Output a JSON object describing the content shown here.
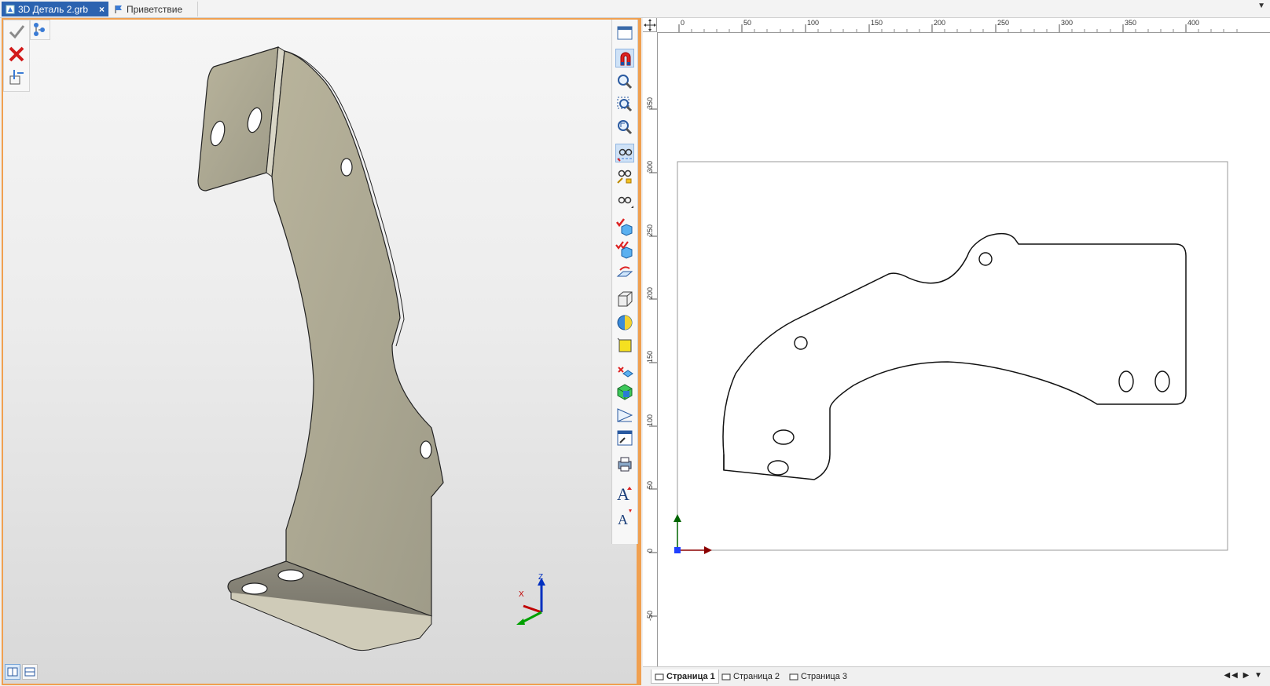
{
  "tabs": [
    {
      "label": "3D Деталь 2.grb",
      "active": true,
      "close": "×"
    },
    {
      "label": "Приветствие",
      "active": false
    }
  ],
  "ruler": {
    "top_labels": [
      "0",
      "50",
      "100",
      "150",
      "200",
      "250",
      "300",
      "350",
      "400"
    ],
    "left_labels": [
      "350",
      "300",
      "250",
      "200",
      "150",
      "100",
      "50",
      "0",
      "-50"
    ]
  },
  "pages": [
    "Страница 1",
    "Страница 2",
    "Страница 3"
  ],
  "page_nav": "◀◀ ▶ ▼",
  "axes": {
    "x": "X",
    "y": "Y",
    "z": "Z"
  },
  "colors": {
    "accent_tab": "#2b63b0",
    "view_border": "#f0a050",
    "part": "#a8a590",
    "axis_x": "#c00000",
    "axis_y": "#00a000",
    "axis_z": "#0030c0"
  }
}
